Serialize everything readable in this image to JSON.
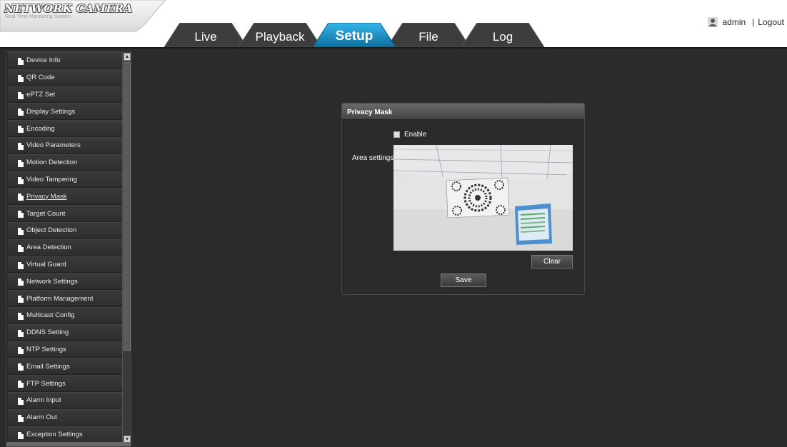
{
  "header": {
    "logo_title": "NETWORK CAMERA",
    "logo_subtitle": "Real-Time Monitoring System",
    "user_name": "admin",
    "separator": "|",
    "logout_label": "Logout"
  },
  "tabs": [
    {
      "label": "Live",
      "active": false
    },
    {
      "label": "Playback",
      "active": false
    },
    {
      "label": "Setup",
      "active": true
    },
    {
      "label": "File",
      "active": false
    },
    {
      "label": "Log",
      "active": false
    }
  ],
  "sidebar": {
    "active_item": "Privacy Mask",
    "items": [
      "Device Info",
      "QR Code",
      "ePTZ Set",
      "Display Settings",
      "Encoding",
      "Video Parameters",
      "Motion Detection",
      "Video Tampering",
      "Privacy Mask",
      "Target Count",
      "Object Detection",
      "Area Detection",
      "Virtual Guard",
      "Network Settings",
      "Platform Management",
      "Multicast Config",
      "DDNS Setting",
      "NTP Settings",
      "Email Settings",
      "FTP Settings",
      "Alarm Input",
      "Alarm Out",
      "Exception Settings"
    ]
  },
  "panel": {
    "title": "Privacy Mask",
    "enable_label": "Enable",
    "enable_checked": false,
    "area_label": "Area settings:",
    "clear_label": "Clear",
    "save_label": "Save"
  },
  "colors": {
    "background": "#2b2b2b",
    "header_bg": "#ffffff",
    "active_tab": "#1e8fc4",
    "inactive_tab": "#3d3d3d"
  },
  "icons": {
    "user": "user-icon",
    "menu_item": "document-icon"
  }
}
